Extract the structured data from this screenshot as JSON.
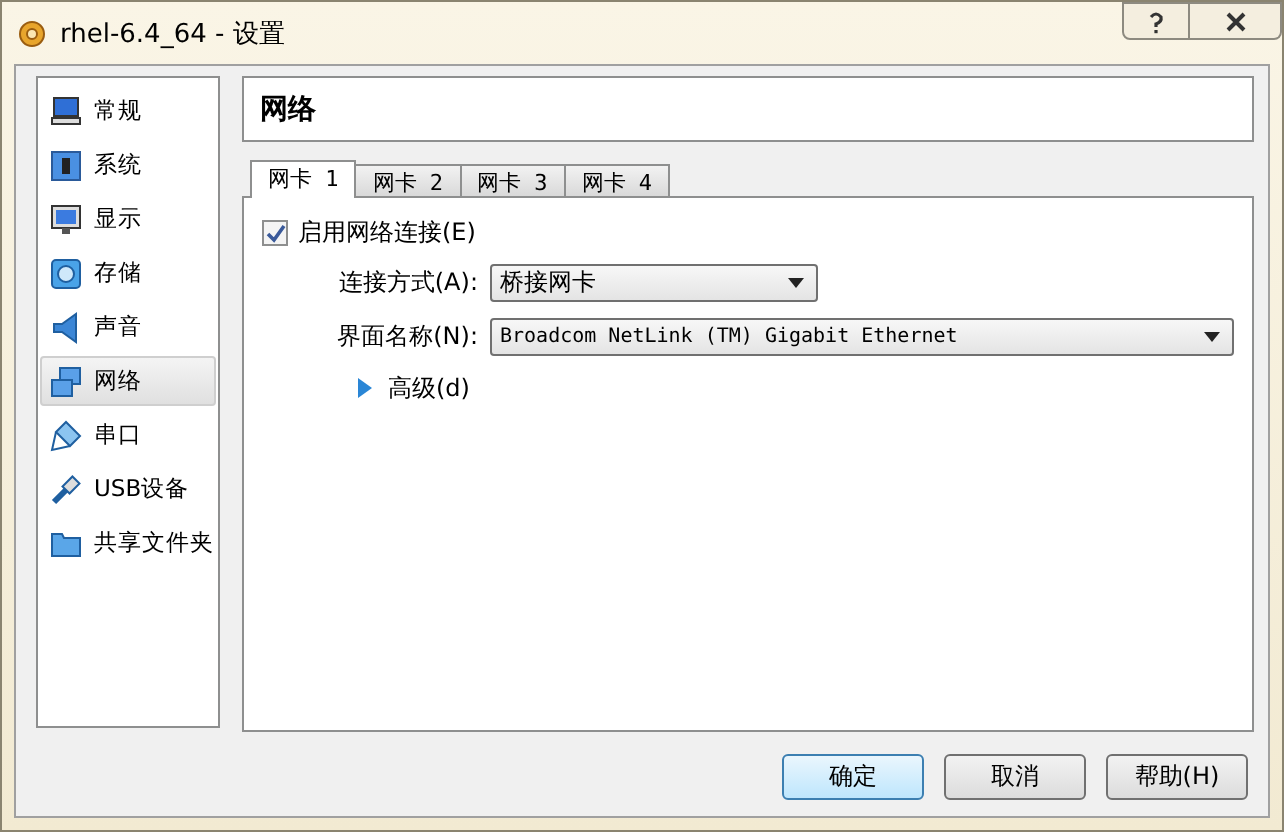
{
  "window": {
    "title": "rhel-6.4_64 - 设置"
  },
  "sidebar": {
    "items": [
      {
        "label": "常规",
        "selected": false
      },
      {
        "label": "系统",
        "selected": false
      },
      {
        "label": "显示",
        "selected": false
      },
      {
        "label": "存储",
        "selected": false
      },
      {
        "label": "声音",
        "selected": false
      },
      {
        "label": "网络",
        "selected": true
      },
      {
        "label": "串口",
        "selected": false
      },
      {
        "label": "USB设备",
        "selected": false
      },
      {
        "label": "共享文件夹",
        "selected": false
      }
    ]
  },
  "section_title": "网络",
  "tabs": [
    {
      "label": "网卡 1",
      "selected": true
    },
    {
      "label": "网卡 2",
      "selected": false
    },
    {
      "label": "网卡 3",
      "selected": false
    },
    {
      "label": "网卡 4",
      "selected": false
    }
  ],
  "enable_checkbox": {
    "label": "启用网络连接(E)",
    "checked": true
  },
  "fields": [
    {
      "label": "连接方式(A):",
      "value": "桥接网卡",
      "kind": "short"
    },
    {
      "label": "界面名称(N):",
      "value": "Broadcom NetLink (TM) Gigabit Ethernet",
      "kind": "wide"
    }
  ],
  "advanced": {
    "label": "高级(d)",
    "expanded": false
  },
  "buttons": [
    {
      "label": "确定",
      "default": true
    },
    {
      "label": "取消",
      "default": false
    },
    {
      "label": "帮助(H)",
      "default": false
    }
  ]
}
